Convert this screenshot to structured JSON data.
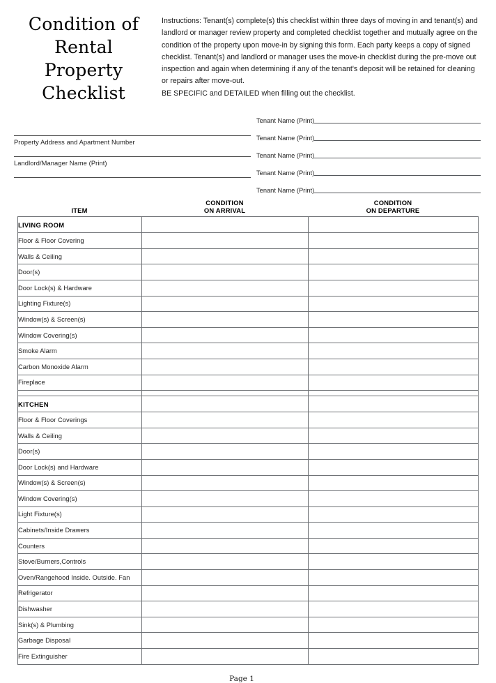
{
  "document": {
    "title_lines": [
      "Condition of",
      "Rental",
      "Property",
      "Checklist"
    ],
    "instructions_paragraph": "Instructions:  Tenant(s) complete(s) this checklist within three days of moving in and tenant(s) and landlord or manager review property and completed checklist together and mutually agree on the condition of the property upon move-in by signing this form.  Each party keeps a copy of signed checklist.  Tenant(s) and landlord or manager uses the move-in checklist during the pre-move out inspection and again when determining if any of the tenant's deposit will be retained for cleaning or repairs after move-out.",
    "instructions_emphasis": "BE SPECIFIC and DETAILED when filling out the checklist.",
    "footer": "Page 1"
  },
  "form": {
    "left_fields": [
      {
        "label": "Property Address and Apartment Number",
        "value": ""
      },
      {
        "label": "Landlord/Manager Name (Print)",
        "value": ""
      },
      {
        "label": "",
        "value": ""
      }
    ],
    "tenant_lines": [
      {
        "label": "Tenant Name (Print)",
        "value": ""
      },
      {
        "label": "Tenant Name (Print)",
        "value": ""
      },
      {
        "label": "Tenant Name (Print)",
        "value": ""
      },
      {
        "label": "Tenant Name (Print)",
        "value": ""
      },
      {
        "label": "Tenant Name (Print)",
        "value": ""
      }
    ]
  },
  "table": {
    "headers": {
      "item": "ITEM",
      "arrival_line1": "CONDITION",
      "arrival_line2": "ON ARRIVAL",
      "departure_line1": "CONDITION",
      "departure_line2": "ON DEPARTURE"
    },
    "rows": [
      {
        "type": "section",
        "item": "LIVING ROOM",
        "arrival": "",
        "departure": ""
      },
      {
        "type": "data",
        "item": "Floor & Floor Covering",
        "arrival": "",
        "departure": ""
      },
      {
        "type": "data",
        "item": "Walls & Ceiling",
        "arrival": "",
        "departure": ""
      },
      {
        "type": "data",
        "item": "Door(s)",
        "arrival": "",
        "departure": ""
      },
      {
        "type": "data",
        "item": "Door Lock(s) & Hardware",
        "arrival": "",
        "departure": ""
      },
      {
        "type": "data",
        "item": "Lighting Fixture(s)",
        "arrival": "",
        "departure": ""
      },
      {
        "type": "data",
        "item": "Window(s) & Screen(s)",
        "arrival": "",
        "departure": ""
      },
      {
        "type": "data",
        "item": "Window Covering(s)",
        "arrival": "",
        "departure": ""
      },
      {
        "type": "data",
        "item": "Smoke Alarm",
        "arrival": "",
        "departure": ""
      },
      {
        "type": "data",
        "item": "Carbon Monoxide Alarm",
        "arrival": "",
        "departure": ""
      },
      {
        "type": "data",
        "item": "Fireplace",
        "arrival": "",
        "departure": ""
      },
      {
        "type": "spacer",
        "item": "",
        "arrival": "",
        "departure": ""
      },
      {
        "type": "section",
        "item": "KITCHEN",
        "arrival": "",
        "departure": ""
      },
      {
        "type": "data",
        "item": "Floor & Floor Coverings",
        "arrival": "",
        "departure": ""
      },
      {
        "type": "data",
        "item": "Walls & Ceiling",
        "arrival": "",
        "departure": ""
      },
      {
        "type": "data",
        "item": "Door(s)",
        "arrival": "",
        "departure": ""
      },
      {
        "type": "data",
        "item": "Door Lock(s) and Hardware",
        "arrival": "",
        "departure": ""
      },
      {
        "type": "data",
        "item": "Window(s) & Screen(s)",
        "arrival": "",
        "departure": ""
      },
      {
        "type": "data",
        "item": "Window Covering(s)",
        "arrival": "",
        "departure": ""
      },
      {
        "type": "data",
        "item": "Light Fixture(s)",
        "arrival": "",
        "departure": ""
      },
      {
        "type": "data",
        "item": "Cabinets/Inside Drawers",
        "arrival": "",
        "departure": ""
      },
      {
        "type": "data",
        "item": "Counters",
        "arrival": "",
        "departure": ""
      },
      {
        "type": "data",
        "item": "Stove/Burners,Controls",
        "arrival": "",
        "departure": ""
      },
      {
        "type": "data",
        "item": "Oven/Rangehood Inside. Outside. Fan",
        "arrival": "",
        "departure": ""
      },
      {
        "type": "data",
        "item": "Refrigerator",
        "arrival": "",
        "departure": ""
      },
      {
        "type": "data",
        "item": "Dishwasher",
        "arrival": "",
        "departure": ""
      },
      {
        "type": "data",
        "item": "Sink(s) & Plumbing",
        "arrival": "",
        "departure": ""
      },
      {
        "type": "data",
        "item": "Garbage Disposal",
        "arrival": "",
        "departure": ""
      },
      {
        "type": "data",
        "item": "Fire Extinguisher",
        "arrival": "",
        "departure": ""
      }
    ]
  }
}
